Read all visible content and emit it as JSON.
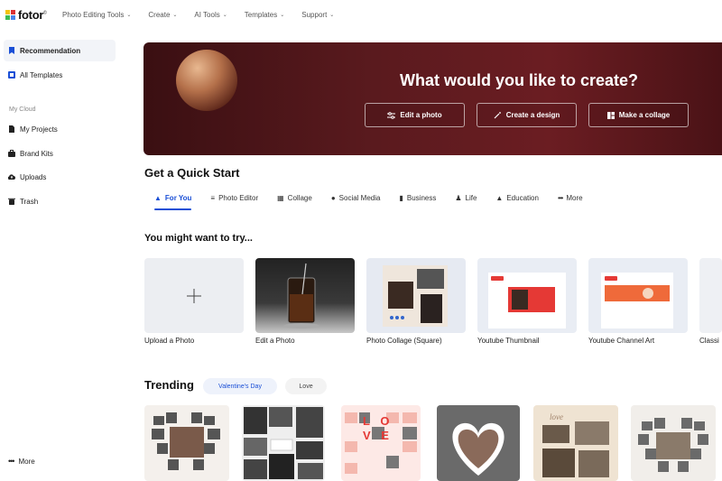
{
  "brand": {
    "name": "fotor",
    "mark": "©"
  },
  "nav": [
    {
      "label": "Photo Editing Tools"
    },
    {
      "label": "Create"
    },
    {
      "label": "AI Tools"
    },
    {
      "label": "Templates"
    },
    {
      "label": "Support"
    }
  ],
  "sidebar": {
    "items": [
      {
        "label": "Recommendation"
      },
      {
        "label": "All Templates"
      }
    ],
    "section_label": "My Cloud",
    "cloud_items": [
      {
        "label": "My Projects"
      },
      {
        "label": "Brand Kits"
      },
      {
        "label": "Uploads"
      },
      {
        "label": "Trash"
      }
    ],
    "more_label": "More"
  },
  "hero": {
    "title": "What would you like to create?",
    "buttons": [
      {
        "label": "Edit a photo"
      },
      {
        "label": "Create a design"
      },
      {
        "label": "Make a collage"
      }
    ]
  },
  "quick_start": {
    "title": "Get a Quick Start",
    "tabs": [
      {
        "label": "For You"
      },
      {
        "label": "Photo Editor"
      },
      {
        "label": "Collage"
      },
      {
        "label": "Social Media"
      },
      {
        "label": "Business"
      },
      {
        "label": "Life"
      },
      {
        "label": "Education"
      },
      {
        "label": "More"
      }
    ]
  },
  "try": {
    "title": "You might want to try...",
    "cards": [
      {
        "label": "Upload a Photo"
      },
      {
        "label": "Edit a Photo"
      },
      {
        "label": "Photo Collage (Square)"
      },
      {
        "label": "Youtube Thumbnail"
      },
      {
        "label": "Youtube Channel Art"
      },
      {
        "label": "Classi"
      }
    ]
  },
  "trending": {
    "title": "Trending",
    "chips": [
      {
        "label": "Valentine's Day"
      },
      {
        "label": "Love"
      }
    ],
    "collage_text": "L O V E"
  },
  "colors": {
    "accent": "#1a4fd6",
    "hero_bg": "#5a1a1e",
    "youtube_red": "#e53935",
    "logo": [
      "#f4c20d",
      "#db3236",
      "#3cba54",
      "#4885ed"
    ]
  }
}
